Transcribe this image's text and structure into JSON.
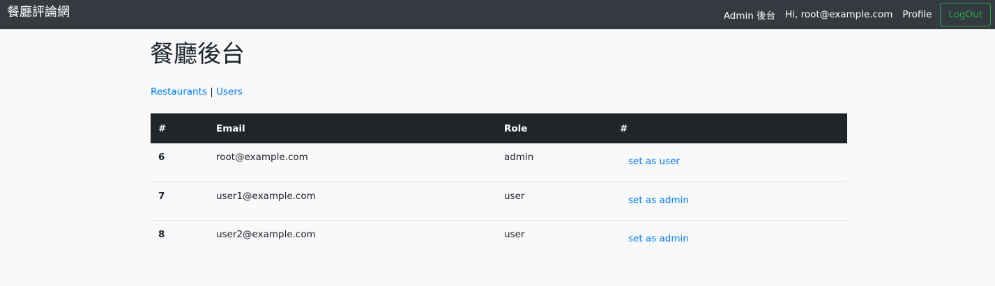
{
  "navbar": {
    "brand": "餐廳評論網",
    "links": {
      "admin": "Admin 後台",
      "greeting": "Hi, root@example.com",
      "profile": "Profile"
    },
    "logout_label": "LogOut"
  },
  "page": {
    "title": "餐廳後台",
    "admin_nav": {
      "restaurants": "Restaurants",
      "separator": "|",
      "users": "Users"
    }
  },
  "table": {
    "headers": [
      "#",
      "Email",
      "Role",
      "#"
    ],
    "rows": [
      {
        "id": "6",
        "email": "root@example.com",
        "role": "admin",
        "action": "set as user"
      },
      {
        "id": "7",
        "email": "user1@example.com",
        "role": "user",
        "action": "set as admin"
      },
      {
        "id": "8",
        "email": "user2@example.com",
        "role": "user",
        "action": "set as admin"
      }
    ]
  },
  "colors": {
    "navbar_bg": "#343a40",
    "table_header_bg": "#212529",
    "link": "#007bff",
    "logout": "#28a745",
    "page_bg": "#f8f9fa"
  }
}
